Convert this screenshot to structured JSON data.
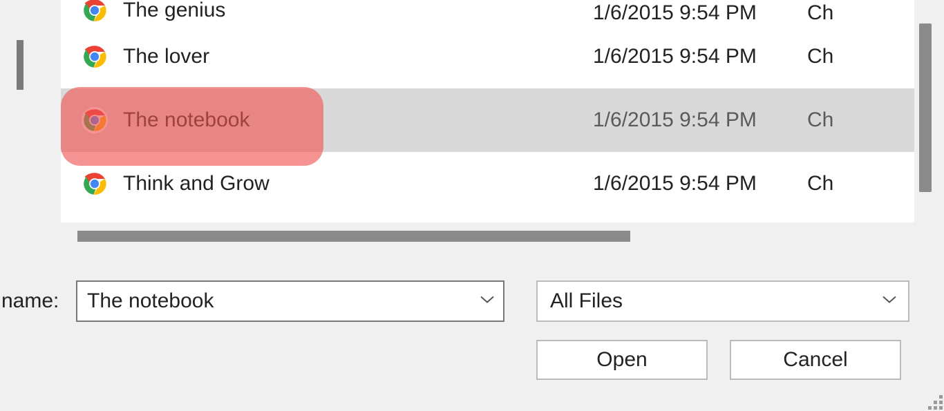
{
  "file_list": {
    "rows": [
      {
        "name": "The genius",
        "date": "1/6/2015 9:54 PM",
        "type": "Ch",
        "partial": true,
        "selected": false
      },
      {
        "name": "The lover",
        "date": "1/6/2015 9:54 PM",
        "type": "Ch",
        "partial": false,
        "selected": false
      },
      {
        "name": "The notebook",
        "date": "1/6/2015 9:54 PM",
        "type": "Ch",
        "partial": false,
        "selected": true
      },
      {
        "name": "Think and Grow",
        "date": "1/6/2015 9:54 PM",
        "type": "Ch",
        "partial": false,
        "selected": false
      }
    ]
  },
  "footer": {
    "name_label": "name:",
    "name_value": "The notebook",
    "filetype_selected": "All Files",
    "open_label": "Open",
    "cancel_label": "Cancel"
  }
}
